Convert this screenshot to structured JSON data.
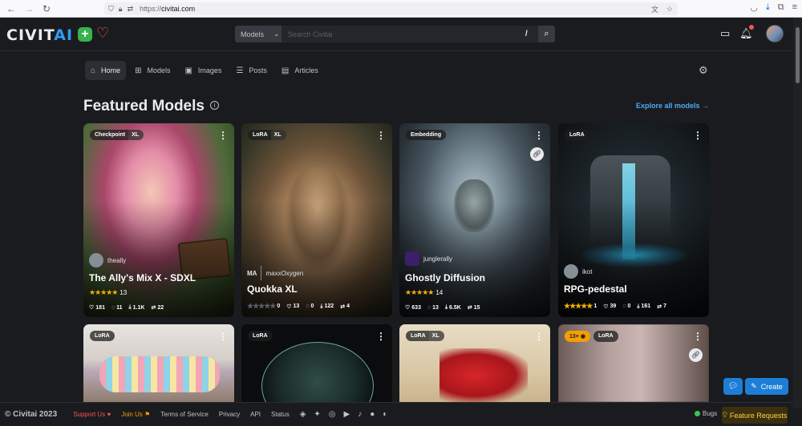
{
  "browser": {
    "url_prefix": "https://",
    "url_host": "civitai.com"
  },
  "header": {
    "logo_main": "CIVIT",
    "logo_accent": "AI",
    "search_scope": "Models",
    "search_placeholder": "Search Civitai",
    "search_shortcut": "/"
  },
  "subnav": [
    {
      "label": "Home",
      "icon": "home-icon"
    },
    {
      "label": "Models",
      "icon": "models-icon"
    },
    {
      "label": "Images",
      "icon": "images-icon"
    },
    {
      "label": "Posts",
      "icon": "posts-icon"
    },
    {
      "label": "Articles",
      "icon": "articles-icon"
    }
  ],
  "section": {
    "title": "Featured Models",
    "explore_link": "Explore all models"
  },
  "cards": [
    {
      "badge1": "Checkpoint",
      "badge2": "XL",
      "creator": "theally",
      "title": "The Ally's Mix X - SDXL",
      "rating_count": "13",
      "stars": 5,
      "likes": "181",
      "comments": "11",
      "downloads": "1.1K",
      "images": "22"
    },
    {
      "badge1": "LoRA",
      "badge2": "XL",
      "creator_prefix": "MA",
      "creator": "maxxOxygen",
      "title": "Quokka XL",
      "rating_count": "0",
      "stars": 0,
      "likes": "13",
      "comments": "0",
      "downloads": "122",
      "images": "4"
    },
    {
      "badge1": "Embedding",
      "creator": "junglerally",
      "title": "Ghostly Diffusion",
      "rating_count": "14",
      "stars": 5,
      "likes": "633",
      "comments": "13",
      "downloads": "6.5K",
      "images": "15"
    },
    {
      "badge1": "LoRA",
      "creator": "ikot",
      "title": "RPG-pedestal",
      "rating_count": "1",
      "stars": 5,
      "likes": "39",
      "comments": "0",
      "downloads": "161",
      "images": "7"
    }
  ],
  "row2": [
    {
      "badge1": "LoRA"
    },
    {
      "badge1": "LoRA"
    },
    {
      "badge1": "LoRA",
      "badge2": "XL"
    },
    {
      "nsfw": "13+",
      "badge1": "LoRA"
    }
  ],
  "fab": {
    "create": "Create"
  },
  "footer": {
    "copyright": "© Civitai 2023",
    "support": "Support Us",
    "join": "Join Us",
    "terms": "Terms of Service",
    "privacy": "Privacy",
    "api": "API",
    "status": "Status",
    "bugs": "Bugs",
    "feature_requests": "Feature Requests"
  }
}
